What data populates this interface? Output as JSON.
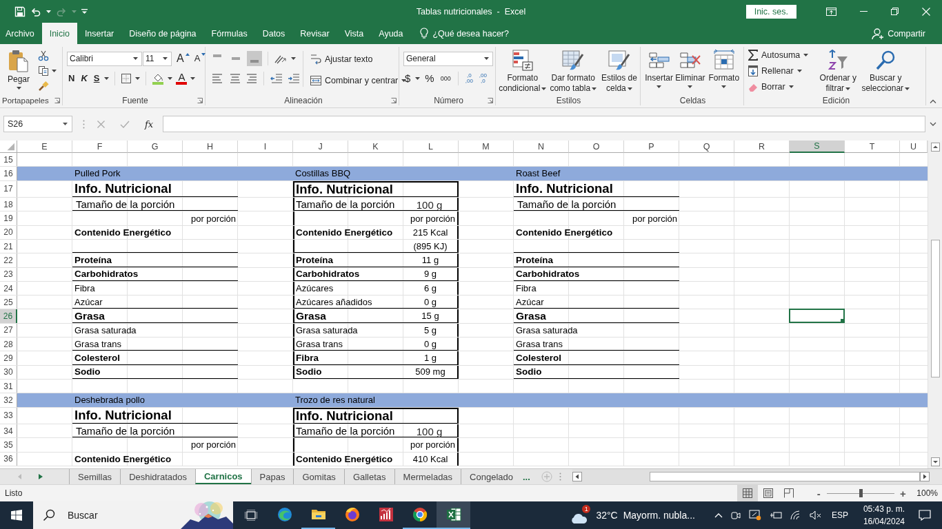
{
  "window": {
    "title": "Tablas nutricionales  -  Excel",
    "sign_in": "Inic. ses."
  },
  "tabs": [
    {
      "label": "Archivo",
      "selected": false
    },
    {
      "label": "Inicio",
      "selected": true
    },
    {
      "label": "Insertar",
      "selected": false
    },
    {
      "label": "Diseño de página",
      "selected": false
    },
    {
      "label": "Fórmulas",
      "selected": false
    },
    {
      "label": "Datos",
      "selected": false
    },
    {
      "label": "Revisar",
      "selected": false
    },
    {
      "label": "Vista",
      "selected": false
    },
    {
      "label": "Ayuda",
      "selected": false
    }
  ],
  "tell_me": "¿Qué desea hacer?",
  "share": "Compartir",
  "ribbon": {
    "clipboard": {
      "label": "Portapapeles",
      "paste": "Pegar"
    },
    "font": {
      "label": "Fuente",
      "font": "Calibri",
      "points": "11",
      "grow": "A",
      "shrink": "A",
      "bold": "N",
      "italic": "K",
      "underline": "S",
      "tint": "A"
    },
    "alignment": {
      "label": "Alineación",
      "vertical_align": [
        {
          "selected": false
        },
        {
          "selected": false
        },
        {
          "selected": true
        }
      ],
      "wrap": "Ajustar texto",
      "merge": "Combinar y centrar"
    },
    "number": {
      "label": "Número",
      "format": "General",
      "currency": "$",
      "percent": "%",
      "thousands": "000",
      "increase_decimals": [
        ",0",
        ",00"
      ],
      "decrease_decimals": [
        ",00",
        ",0"
      ]
    },
    "styles": {
      "label": "Estilos",
      "conditional": "Formato condicional",
      "as_table": "Dar formato como tabla",
      "cell_styles": "Estilos de celda"
    },
    "cells": {
      "label": "Celdas",
      "insert": "Insertar",
      "delete": "Eliminar",
      "format": "Formato"
    },
    "editing": {
      "label": "Edición",
      "autosum": "Autosuma",
      "fill": "Rellenar",
      "clear": "Borrar",
      "sort": "Ordenar y filtrar",
      "find": "Buscar y seleccionar"
    }
  },
  "formula_bar": {
    "name_box": "S26",
    "function_label": "fx"
  },
  "sheet": {
    "columns": [
      {
        "label": "E",
        "selected": false
      },
      {
        "label": "F",
        "selected": false
      },
      {
        "label": "G",
        "selected": false
      },
      {
        "label": "H",
        "selected": false
      },
      {
        "label": "I",
        "selected": false
      },
      {
        "label": "J",
        "selected": false
      },
      {
        "label": "K",
        "selected": false
      },
      {
        "label": "L",
        "selected": false
      },
      {
        "label": "M",
        "selected": false
      },
      {
        "label": "N",
        "selected": false
      },
      {
        "label": "O",
        "selected": false
      },
      {
        "label": "P",
        "selected": false
      },
      {
        "label": "Q",
        "selected": false
      },
      {
        "label": "R",
        "selected": false
      },
      {
        "label": "S",
        "selected": true
      },
      {
        "label": "T",
        "selected": false
      },
      {
        "label": "U",
        "selected": false
      }
    ],
    "rows": [
      {
        "number": "15",
        "selected": false,
        "band": false
      },
      {
        "number": "16",
        "selected": false,
        "band": true,
        "segments": [
          {
            "kind": "caption",
            "label": "Pulled Pork"
          },
          {
            "kind": "caption",
            "label": "Costillas BBQ"
          },
          {
            "kind": "caption",
            "label": "Roast Beef"
          }
        ]
      },
      {
        "number": "17",
        "selected": false,
        "band": false,
        "segments": [
          {
            "kind": "title",
            "label": "Info. Nutricional",
            "rule": true,
            "boxed": false
          },
          {
            "kind": "title",
            "label": "Info. Nutricional",
            "rule": true,
            "boxed": true
          },
          {
            "kind": "title",
            "label": "Info. Nutricional",
            "rule": true,
            "boxed": false
          }
        ]
      },
      {
        "number": "18",
        "selected": false,
        "band": false,
        "segments": [
          {
            "kind": "portion",
            "label": "Tamaño de la porción",
            "rule": true,
            "boxed": false
          },
          {
            "kind": "portion",
            "label": "Tamaño de la porción",
            "value": "100 g",
            "rule": true,
            "boxed": true
          },
          {
            "kind": "portion",
            "label": "Tamaño de la porción",
            "rule": true,
            "boxed": false
          }
        ]
      },
      {
        "number": "19",
        "selected": false,
        "band": false,
        "segments": [
          {
            "kind": "per",
            "value": "por porción",
            "rule": false,
            "boxed": false
          },
          {
            "kind": "per",
            "value": "por porción",
            "rule": false,
            "boxed": true
          },
          {
            "kind": "per",
            "value": "por porción",
            "rule": false,
            "boxed": false
          }
        ]
      },
      {
        "number": "20",
        "selected": false,
        "band": false,
        "segments": [
          {
            "kind": "energy",
            "label": "Contenido Energético",
            "rule": false,
            "boxed": false
          },
          {
            "kind": "energy",
            "label": "Contenido Energético",
            "value": "215 Kcal",
            "rule": false,
            "boxed": true
          },
          {
            "kind": "energy",
            "label": "Contenido Energético",
            "rule": false,
            "boxed": false
          }
        ]
      },
      {
        "number": "21",
        "selected": false,
        "band": false,
        "segments": [
          {
            "kind": "sub",
            "rule": true,
            "boxed": false
          },
          {
            "kind": "sub",
            "value": "(895 KJ)",
            "rule": true,
            "boxed": true
          },
          {
            "kind": "sub",
            "rule": true,
            "boxed": false
          }
        ]
      },
      {
        "number": "22",
        "selected": false,
        "band": false,
        "segments": [
          {
            "kind": "nutrient",
            "label": "Proteína",
            "rule": true,
            "boxed": false
          },
          {
            "kind": "nutrient",
            "label": "Proteína",
            "value": "11 g",
            "rule": true,
            "boxed": true
          },
          {
            "kind": "nutrient",
            "label": "Proteína",
            "rule": true,
            "boxed": false
          }
        ]
      },
      {
        "number": "23",
        "selected": false,
        "band": false,
        "segments": [
          {
            "kind": "nutrient",
            "label": "Carbohidratos",
            "rule": true,
            "boxed": false
          },
          {
            "kind": "nutrient",
            "label": "Carbohidratos",
            "value": "9 g",
            "rule": true,
            "boxed": true
          },
          {
            "kind": "nutrient",
            "label": "Carbohidratos",
            "rule": true,
            "boxed": false
          }
        ]
      },
      {
        "number": "24",
        "selected": false,
        "band": false,
        "segments": [
          {
            "kind": "sub",
            "label": "Fibra",
            "rule": false,
            "boxed": false
          },
          {
            "kind": "sub",
            "label": "Azúcares",
            "value": "6 g",
            "rule": false,
            "boxed": true
          },
          {
            "kind": "sub",
            "label": "Fibra",
            "rule": false,
            "boxed": false
          }
        ]
      },
      {
        "number": "25",
        "selected": false,
        "band": false,
        "segments": [
          {
            "kind": "sub",
            "label": "Azúcar",
            "rule": true,
            "boxed": false
          },
          {
            "kind": "sub",
            "label": "Azúcares añadidos",
            "value": "0 g",
            "rule": true,
            "boxed": true
          },
          {
            "kind": "sub",
            "label": "Azúcar",
            "rule": true,
            "boxed": false
          }
        ]
      },
      {
        "number": "26",
        "selected": true,
        "band": false,
        "segments": [
          {
            "kind": "fat",
            "label": "Grasa",
            "rule": true,
            "boxed": false
          },
          {
            "kind": "fat",
            "label": "Grasa",
            "value": "15 g",
            "rule": true,
            "boxed": true
          },
          {
            "kind": "fat",
            "label": "Grasa",
            "rule": true,
            "boxed": false
          }
        ]
      },
      {
        "number": "27",
        "selected": false,
        "band": false,
        "segments": [
          {
            "kind": "sub",
            "label": "Grasa saturada",
            "rule": false,
            "boxed": false
          },
          {
            "kind": "sub",
            "label": "Grasa saturada",
            "value": "5 g",
            "rule": false,
            "boxed": true
          },
          {
            "kind": "sub",
            "label": "Grasa saturada",
            "rule": false,
            "boxed": false
          }
        ]
      },
      {
        "number": "28",
        "selected": false,
        "band": false,
        "segments": [
          {
            "kind": "sub",
            "label": "Grasa trans",
            "rule": true,
            "boxed": false
          },
          {
            "kind": "sub",
            "label": "Grasa trans",
            "value": "0 g",
            "rule": true,
            "boxed": true
          },
          {
            "kind": "sub",
            "label": "Grasa trans",
            "rule": true,
            "boxed": false
          }
        ]
      },
      {
        "number": "29",
        "selected": false,
        "band": false,
        "segments": [
          {
            "kind": "nutrient",
            "label": "Colesterol",
            "rule": true,
            "boxed": false
          },
          {
            "kind": "nutrient",
            "label": "Fibra",
            "value": "1 g",
            "rule": true,
            "boxed": true
          },
          {
            "kind": "nutrient",
            "label": "Colesterol",
            "rule": true,
            "boxed": false
          }
        ]
      },
      {
        "number": "30",
        "selected": false,
        "band": false,
        "segments": [
          {
            "kind": "nutrient",
            "label": "Sodio",
            "rule": true,
            "boxed": false
          },
          {
            "kind": "nutrient",
            "label": "Sodio",
            "value": "509 mg",
            "rule": true,
            "boxed": true
          },
          {
            "kind": "nutrient",
            "label": "Sodio",
            "rule": true,
            "boxed": false
          }
        ]
      },
      {
        "number": "31",
        "selected": false,
        "band": false
      },
      {
        "number": "32",
        "selected": false,
        "band": true,
        "segments": [
          {
            "kind": "caption",
            "label": "Deshebrada pollo"
          },
          {
            "kind": "caption",
            "label": "Trozo de res natural"
          }
        ]
      },
      {
        "number": "33",
        "selected": false,
        "band": false,
        "segments": [
          {
            "kind": "title",
            "label": "Info. Nutricional",
            "rule": true,
            "boxed": false
          },
          {
            "kind": "title",
            "label": "Info. Nutricional",
            "rule": true,
            "boxed": true
          }
        ]
      },
      {
        "number": "34",
        "selected": false,
        "band": false,
        "segments": [
          {
            "kind": "portion",
            "label": "Tamaño de la porción",
            "rule": true,
            "boxed": false
          },
          {
            "kind": "portion",
            "label": "Tamaño de la porción",
            "value": "100 g",
            "rule": true,
            "boxed": true
          }
        ]
      },
      {
        "number": "35",
        "selected": false,
        "band": false,
        "segments": [
          {
            "kind": "per",
            "value": "por porción",
            "rule": false,
            "boxed": false
          },
          {
            "kind": "per",
            "value": "por porción",
            "rule": false,
            "boxed": true
          }
        ]
      },
      {
        "number": "36",
        "selected": false,
        "band": false,
        "segments": [
          {
            "kind": "energy",
            "label": "Contenido Energético",
            "rule": false,
            "boxed": false
          },
          {
            "kind": "energy",
            "label": "Contenido Energético",
            "value": "410 Kcal",
            "rule": false,
            "boxed": true
          }
        ]
      }
    ]
  },
  "sheet_tabs": [
    {
      "label": "Semillas",
      "selected": false
    },
    {
      "label": "Deshidratados",
      "selected": false
    },
    {
      "label": "Carnicos",
      "selected": true
    },
    {
      "label": "Papas",
      "selected": false
    },
    {
      "label": "Gomitas",
      "selected": false
    },
    {
      "label": "Galletas",
      "selected": false
    },
    {
      "label": "Mermeladas",
      "selected": false
    },
    {
      "label": "Congelado",
      "selected": false
    }
  ],
  "more_sheets": "...",
  "status_bar": {
    "text": "Listo",
    "views": [
      {
        "selected": true
      },
      {
        "selected": false
      },
      {
        "selected": false
      }
    ],
    "zoom": {
      "minus": "-",
      "plus": "+",
      "level": 0.5,
      "reading": "100%"
    }
  },
  "taskbar": {
    "search": "Buscar",
    "apps": [
      {
        "running": false,
        "selected": false
      },
      {
        "running": true,
        "selected": false
      },
      {
        "running": false,
        "selected": false
      },
      {
        "running": false,
        "selected": false
      },
      {
        "running": true,
        "selected": false
      },
      {
        "running": true,
        "selected": true
      }
    ],
    "weather": {
      "badge": "1",
      "temperature": "32°C",
      "forecast": "Mayorm. nubla..."
    },
    "language": "ESP",
    "time": "05:43 p. m.",
    "date": "16/04/2024"
  }
}
